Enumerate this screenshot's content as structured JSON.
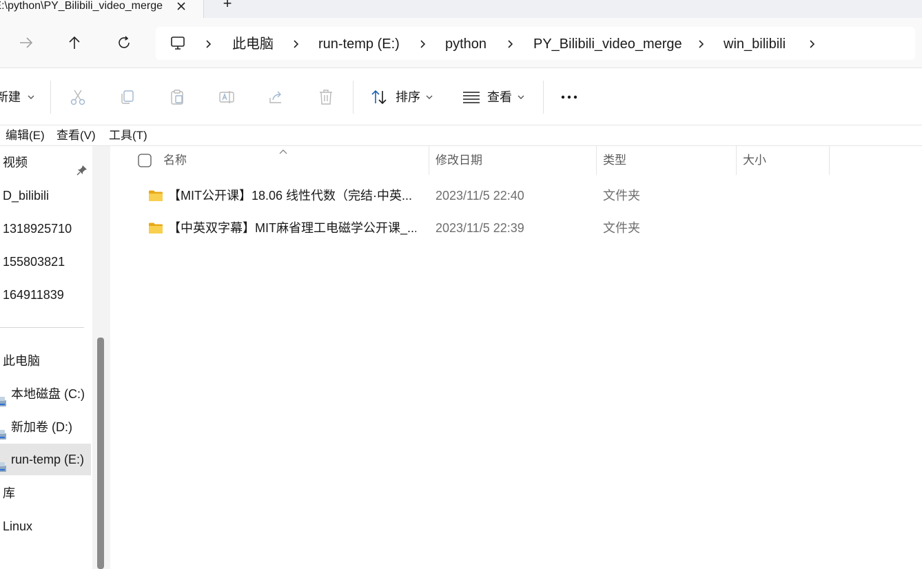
{
  "window": {
    "tab_title": "E:\\python\\PY_Bilibili_video_merge",
    "new_tab_label": "+"
  },
  "breadcrumb": [
    "此电脑",
    "run-temp (E:)",
    "python",
    "PY_Bilibili_video_merge",
    "win_bilibili"
  ],
  "command_bar": {
    "new_label": "新建",
    "sort_label": "排序",
    "view_label": "查看"
  },
  "menu": [
    "编辑(E)",
    "查看(V)",
    "工具(T)"
  ],
  "sidebar": {
    "quick_access": [
      {
        "label": "视频",
        "pinned": true
      },
      {
        "label": "D_bilibili"
      },
      {
        "label": "1318925710"
      },
      {
        "label": "155803821"
      },
      {
        "label": "164911839"
      }
    ],
    "this_pc": {
      "label": "此电脑"
    },
    "drives": [
      {
        "label": "本地磁盘 (C:)",
        "selected": false
      },
      {
        "label": "新加卷 (D:)",
        "selected": false
      },
      {
        "label": "run-temp (E:)",
        "selected": true
      }
    ],
    "others": [
      {
        "label": "库"
      },
      {
        "label": "Linux"
      }
    ]
  },
  "columns": {
    "name": "名称",
    "modified": "修改日期",
    "type": "类型",
    "size": "大小"
  },
  "files": [
    {
      "name": "【MIT公开课】18.06 线性代数（完结·中英...",
      "modified": "2023/11/5 22:40",
      "type": "文件夹",
      "size": ""
    },
    {
      "name": "【中英双字幕】MIT麻省理工电磁学公开课_...",
      "modified": "2023/11/5 22:39",
      "type": "文件夹",
      "size": ""
    }
  ],
  "colors": {
    "folder": "#f5c542",
    "folder_dark": "#e8a917",
    "selected_bg": "#e5e5e5",
    "scroll_thumb": "#8a8a8a"
  }
}
